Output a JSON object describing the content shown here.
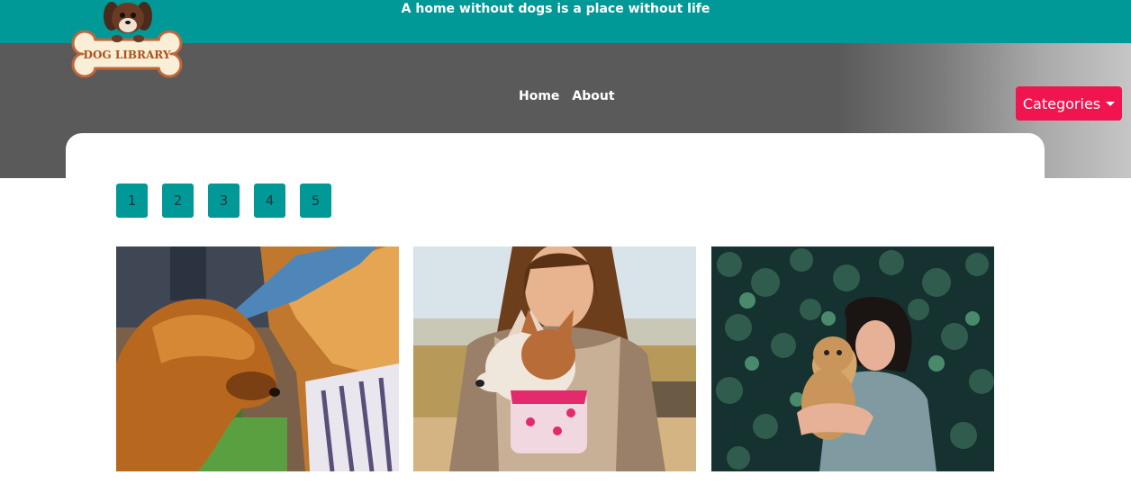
{
  "header": {
    "tagline": "A home without dogs is a place without life"
  },
  "logo": {
    "text": "DOG LIBRARY"
  },
  "nav": {
    "home": "Home",
    "about": "About"
  },
  "categories": {
    "label": "Categories"
  },
  "pagination": {
    "pages": [
      "1",
      "2",
      "3",
      "4",
      "5"
    ]
  },
  "photos": [
    {
      "icon": "golden-retriever-with-woman-in-hat-photo"
    },
    {
      "icon": "woman-holding-chihuahua-photo"
    },
    {
      "icon": "woman-hugging-small-dog-in-ivy-photo"
    }
  ],
  "colors": {
    "teal": "#009997",
    "hero_gray": "#5a5a5a",
    "accent_pink": "#f0154f"
  }
}
